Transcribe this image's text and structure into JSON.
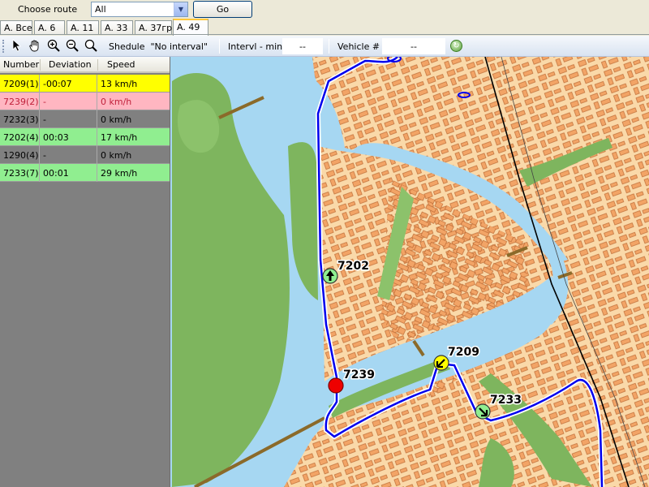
{
  "route_selector": {
    "label": "Choose route",
    "value": "All",
    "go_label": "Go"
  },
  "tabs": [
    {
      "label": "A. Все"
    },
    {
      "label": "A. 6"
    },
    {
      "label": "A. 11"
    },
    {
      "label": "A. 33"
    },
    {
      "label": "A. 37гр"
    },
    {
      "label": "A. 49",
      "active": true
    }
  ],
  "toolbar": {
    "tools": [
      "pointer-icon",
      "pan-hand-icon",
      "zoom-in-icon",
      "zoom-out-icon",
      "zoom-fit-icon"
    ],
    "schedule_label": "Shedule  \"No interval\"",
    "interval_label": "Intervl - min",
    "interval_value": "--",
    "vehicle_label": "Vehicle #",
    "vehicle_value": "--",
    "refresh_icon": "refresh-icon"
  },
  "grid": {
    "columns": [
      "Number",
      "Deviation",
      "Speed"
    ],
    "rows": [
      {
        "number": "7209(1)",
        "deviation": "-00:07",
        "speed": "13 km/h",
        "color": "#ffff00",
        "text_color": "#000000"
      },
      {
        "number": "7239(2)",
        "deviation": "-",
        "speed": "0 km/h",
        "color": "#ffb6c1",
        "text_color": "#c0203a"
      },
      {
        "number": "7232(3)",
        "deviation": "-",
        "speed": "0 km/h",
        "color": "#808080",
        "text_color": "#000000"
      },
      {
        "number": "7202(4)",
        "deviation": "00:03",
        "speed": "17 km/h",
        "color": "#90ee90",
        "text_color": "#000000"
      },
      {
        "number": "1290(4)",
        "deviation": "-",
        "speed": "0 km/h",
        "color": "#808080",
        "text_color": "#000000"
      },
      {
        "number": "7233(7)",
        "deviation": "00:01",
        "speed": "29 km/h",
        "color": "#90ee90",
        "text_color": "#000000"
      }
    ]
  },
  "map": {
    "colors": {
      "background": "#fad9a9",
      "water": "#a6d7f2",
      "park": "#7eb55e",
      "building": "#f2a466",
      "route": "#0000ee"
    },
    "vehicles": [
      {
        "id": "7202",
        "status": "on-time",
        "color": "#90ee90"
      },
      {
        "id": "7209",
        "status": "late",
        "color": "#ffff00"
      },
      {
        "id": "7239",
        "status": "stopped",
        "color": "#ee0000"
      },
      {
        "id": "7233",
        "status": "on-time",
        "color": "#90ee90"
      }
    ]
  }
}
